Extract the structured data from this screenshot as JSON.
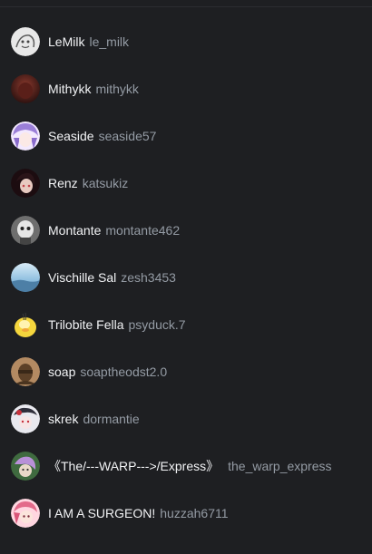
{
  "members": [
    {
      "display_name": "LeMilk",
      "username": "le_milk",
      "avatar_icon": "sketch-avatar-icon",
      "colors": [
        "#e8e8e8",
        "#6b6b6b"
      ]
    },
    {
      "display_name": "Mithykk",
      "username": "mithykk",
      "avatar_icon": "dark-red-avatar-icon",
      "colors": [
        "#7a2d25",
        "#3a1512"
      ]
    },
    {
      "display_name": "Seaside",
      "username": "seaside57",
      "avatar_icon": "anime-purple-avatar-icon",
      "colors": [
        "#b9a6e8",
        "#f3e9ff"
      ]
    },
    {
      "display_name": "Renz",
      "username": "katsukiz",
      "avatar_icon": "dark-anime-avatar-icon",
      "colors": [
        "#2a1418",
        "#c2444a"
      ]
    },
    {
      "display_name": "Montante",
      "username": "montante462",
      "avatar_icon": "grey-character-avatar-icon",
      "colors": [
        "#8a8a8a",
        "#e6e6e6"
      ]
    },
    {
      "display_name": "Vischille Sal",
      "username": "zesh3453",
      "avatar_icon": "sky-landscape-avatar-icon",
      "colors": [
        "#6fa8d6",
        "#d9ecf7"
      ]
    },
    {
      "display_name": "Trilobite Fella",
      "username": "psyduck.7",
      "avatar_icon": "yellow-duck-avatar-icon",
      "colors": [
        "#f5d63d",
        "#fff3b0"
      ]
    },
    {
      "display_name": "soap",
      "username": "soaptheodst2.0",
      "avatar_icon": "brown-soldier-avatar-icon",
      "colors": [
        "#7a5a3a",
        "#c8a27a"
      ]
    },
    {
      "display_name": "skrek",
      "username": "dormantie",
      "avatar_icon": "red-white-anime-avatar-icon",
      "colors": [
        "#e9e9ef",
        "#c8323c"
      ]
    },
    {
      "display_name": "《The/---WARP--->/Express》",
      "username": "the_warp_express",
      "avatar_icon": "green-purple-avatar-icon",
      "colors": [
        "#4a7a4a",
        "#b890d8"
      ]
    },
    {
      "display_name": "I AM A SURGEON!",
      "username": "huzzah6711",
      "avatar_icon": "pink-anime-avatar-icon",
      "colors": [
        "#e36a8a",
        "#ffd6e0"
      ]
    }
  ]
}
